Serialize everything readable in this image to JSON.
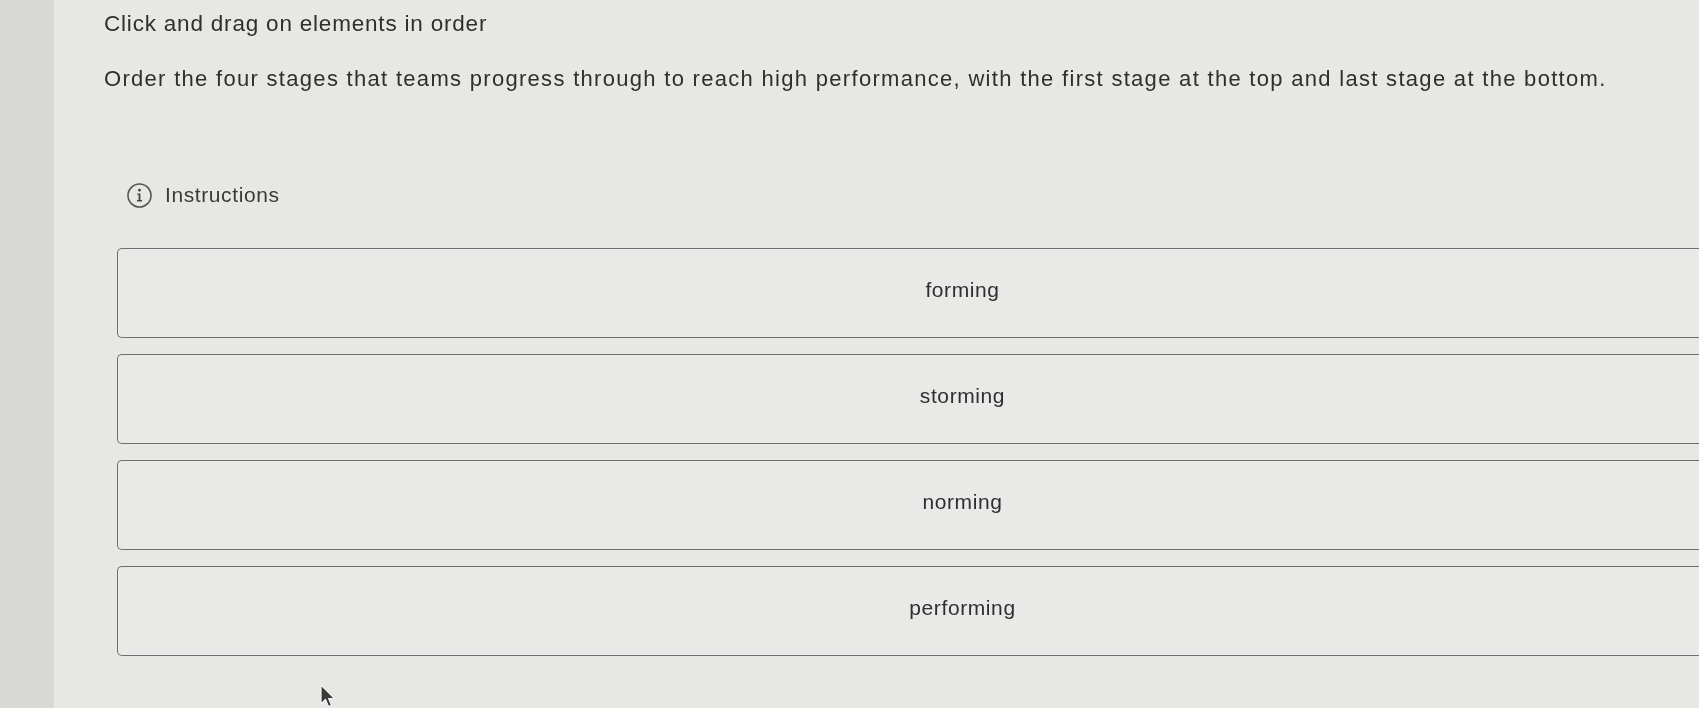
{
  "title": "Click and drag on elements in order",
  "prompt": "Order the four stages that teams progress through to reach high performance, with the first stage at the top and last stage at the bottom.",
  "instructions": {
    "label": "Instructions"
  },
  "items": [
    {
      "label": "forming"
    },
    {
      "label": "storming"
    },
    {
      "label": "norming"
    },
    {
      "label": "performing"
    }
  ]
}
